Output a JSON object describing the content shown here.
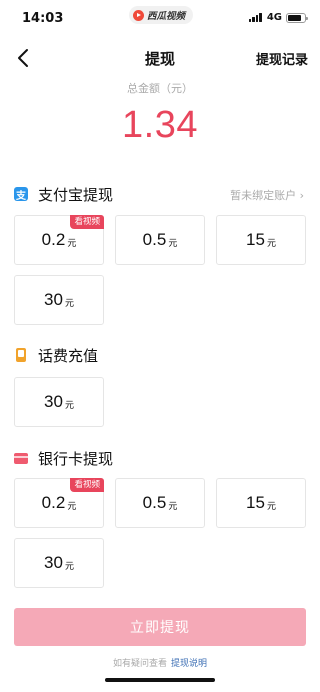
{
  "status_bar": {
    "time": "14:03",
    "app_name": "西瓜视频",
    "network": "4G"
  },
  "nav": {
    "title": "提现",
    "record_link": "提现记录"
  },
  "total": {
    "label": "总金额（元）",
    "amount": "1.34",
    "accent_color": "#e8455c"
  },
  "unit": "元",
  "sections": [
    {
      "title": "支付宝提现",
      "icon": "alipay-icon",
      "link": "暂未绑定账户 ›",
      "options": [
        {
          "value": "0.2",
          "badge": "看视频"
        },
        {
          "value": "0.5"
        },
        {
          "value": "15"
        },
        {
          "value": "30"
        }
      ]
    },
    {
      "title": "话费充值",
      "icon": "phone-icon",
      "options": [
        {
          "value": "30"
        }
      ]
    },
    {
      "title": "银行卡提现",
      "icon": "bank-card-icon",
      "options": [
        {
          "value": "0.2",
          "badge": "看视频"
        },
        {
          "value": "0.5"
        },
        {
          "value": "15"
        },
        {
          "value": "30"
        }
      ]
    }
  ],
  "bottom": {
    "button_label": "立即提现",
    "button_color": "#f5a9b7",
    "help_text": "如有疑问查看",
    "help_link": "提现说明"
  }
}
